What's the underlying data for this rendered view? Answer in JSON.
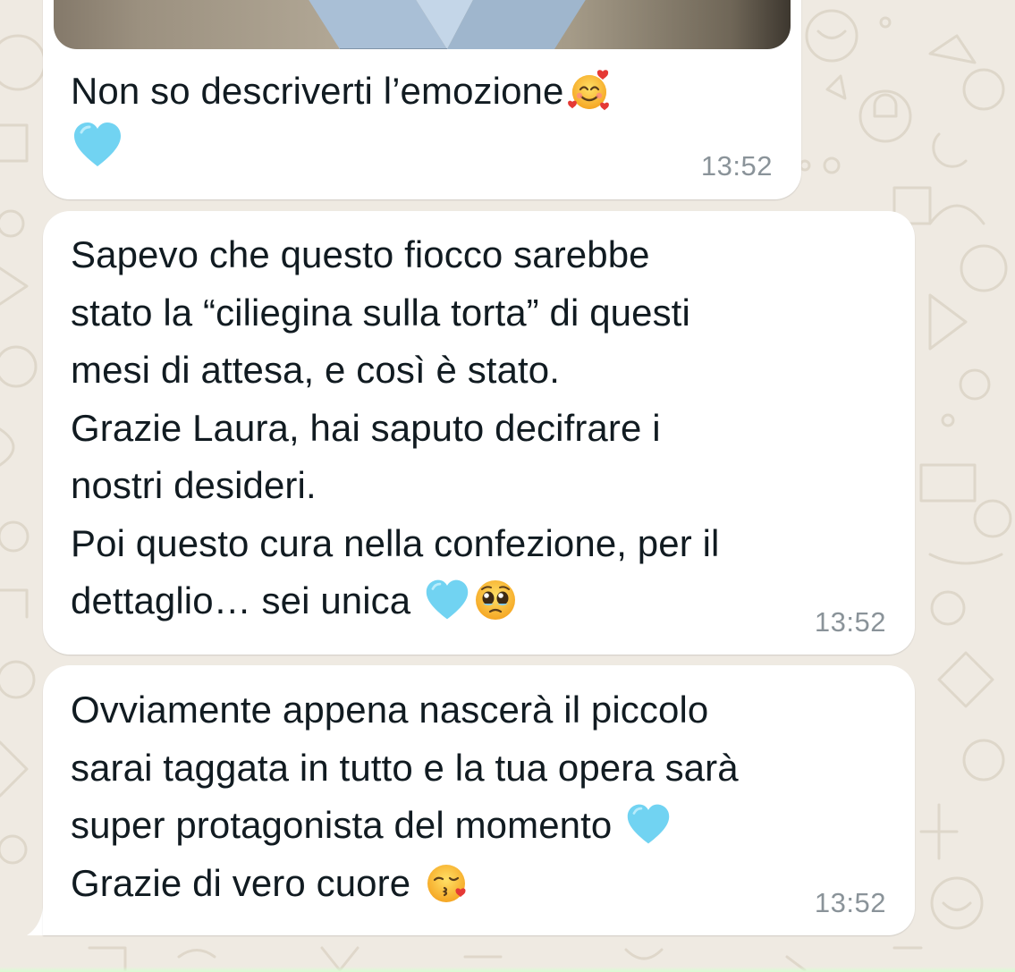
{
  "chat": {
    "messages": [
      {
        "text": "Non so descriverti l’emozione",
        "time": "13:52",
        "has_image": true,
        "emojis": [
          "smiling-face-with-hearts",
          "light-blue-heart"
        ]
      },
      {
        "text": "Sapevo che questo fiocco sarebbe\nstato la “ciliegina sulla torta” di questi\nmesi di attesa, e così è stato.\nGrazie Laura, hai saputo decifrare i\nnostri desideri.\nPoi questo cura nella confezione, per il\ndettaglio… sei unica",
        "time": "13:52",
        "emojis": [
          "light-blue-heart",
          "pleading-face"
        ]
      },
      {
        "text_a": "Ovviamente appena nascerà il piccolo\nsarai taggata in tutto e la tua opera sarà\nsuper protagonista del momento",
        "text_b": "Grazie di vero cuore",
        "time": "13:52",
        "emojis": [
          "light-blue-heart",
          "face-blowing-a-kiss"
        ]
      }
    ]
  },
  "colors": {
    "wallpaper": "#efeae2",
    "bubble": "#ffffff",
    "text": "#111b21",
    "time": "#8a9399",
    "heart": "#71d3f2"
  }
}
